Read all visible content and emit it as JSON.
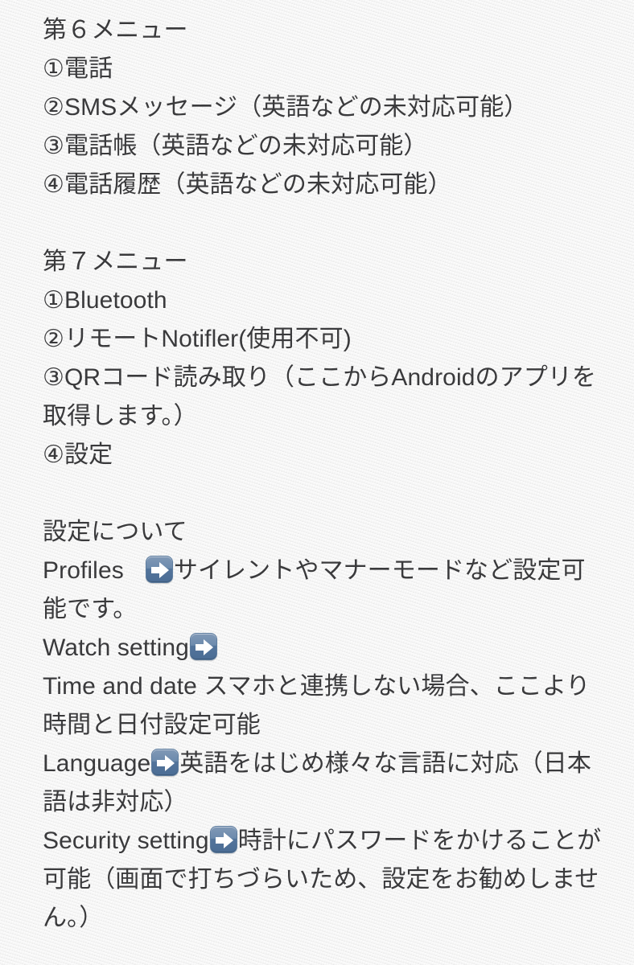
{
  "page": {
    "background_color": "#f4f4f3",
    "text_color": "#3a3a3c",
    "accent_color": "#5b7fa6",
    "arrow_icon_name": "right-arrow-emoji"
  },
  "blocks": [
    {
      "id": "menu-6",
      "heading": "第６メニュー",
      "items": [
        "①電話",
        "②SMSメッセージ（英語などの未対応可能）",
        "③電話帳（英語などの未対応可能）",
        "④電話履歴（英語などの未対応可能）"
      ]
    },
    {
      "id": "menu-7",
      "heading": "第７メニュー",
      "items": [
        "①Bluetooth",
        "②リモートNotifler(使用不可)",
        "③QRコード読み取り（ここからAndroidのアプリを取得します。）",
        "④設定"
      ]
    }
  ],
  "settings_section": {
    "heading": "設定について",
    "entries": [
      {
        "id": "profiles",
        "label": "Profiles",
        "gap": true,
        "arrow": true,
        "description": "サイレントやマナーモードなど設定可能です。"
      },
      {
        "id": "watch-setting",
        "label": "Watch setting",
        "gap": false,
        "arrow": true,
        "description": ""
      },
      {
        "id": "time-and-date",
        "label": "Time and date ",
        "gap": false,
        "arrow": false,
        "description": "スマホと連携しない場合、ここより時間と日付設定可能"
      },
      {
        "id": "language",
        "label": "Language",
        "gap": false,
        "arrow": true,
        "description": "英語をはじめ様々な言語に対応（日本語は非対応）"
      },
      {
        "id": "security-setting",
        "label": "Security setting",
        "gap": false,
        "arrow": true,
        "description": "時計にパスワードをかけることが可能（画面で打ちづらいため、設定をお勧めしません。）"
      }
    ]
  }
}
